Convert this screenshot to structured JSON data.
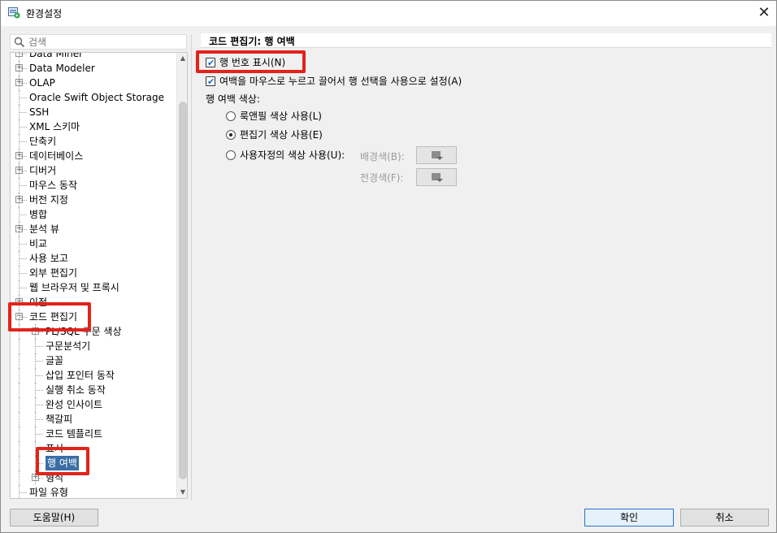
{
  "window": {
    "title": "환경설정"
  },
  "search": {
    "placeholder": "검색"
  },
  "tree": {
    "items": [
      {
        "label": "Data Miner",
        "expandable": true
      },
      {
        "label": "Data Modeler",
        "expandable": true
      },
      {
        "label": "OLAP",
        "expandable": true
      },
      {
        "label": "Oracle Swift Object Storage",
        "expandable": false
      },
      {
        "label": "SSH",
        "expandable": false
      },
      {
        "label": "XML 스키마",
        "expandable": false
      },
      {
        "label": "단축키",
        "expandable": false
      },
      {
        "label": "데이터베이스",
        "expandable": true
      },
      {
        "label": "디버거",
        "expandable": true
      },
      {
        "label": "마우스 동작",
        "expandable": false
      },
      {
        "label": "버전 지정",
        "expandable": true
      },
      {
        "label": "병합",
        "expandable": false
      },
      {
        "label": "분석 뷰",
        "expandable": true
      },
      {
        "label": "비교",
        "expandable": false
      },
      {
        "label": "사용 보고",
        "expandable": false
      },
      {
        "label": "외부 편집기",
        "expandable": false
      },
      {
        "label": "웹 브라우저 및 프록시",
        "expandable": false
      },
      {
        "label": "이전",
        "expandable": true
      },
      {
        "label": "코드 편집기",
        "expandable": true,
        "expanded": true
      },
      {
        "label": "PL/SQL 구문 색상",
        "expandable": true,
        "child": true
      },
      {
        "label": "구문분석기",
        "child": true
      },
      {
        "label": "글꼴",
        "child": true
      },
      {
        "label": "삽입 포인터 동작",
        "child": true
      },
      {
        "label": "실행 취소 동작",
        "child": true
      },
      {
        "label": "완성 인사이트",
        "child": true
      },
      {
        "label": "책갈피",
        "child": true
      },
      {
        "label": "코드 템플리트",
        "child": true
      },
      {
        "label": "표시",
        "child": true
      },
      {
        "label": "행 여백",
        "child": true,
        "selected": true
      },
      {
        "label": "형식",
        "expandable": true,
        "child": true
      },
      {
        "label": "파일 유형",
        "expandable": false
      }
    ]
  },
  "panel": {
    "title": "코드 편집기: 행 여백",
    "show_line_numbers": {
      "label": "행 번호 표시(N)",
      "checked": true
    },
    "select_lines_drag": {
      "label": "여백을 마우스로 누르고 끌어서 행 선택을 사용으로 설정(A)",
      "checked": true
    },
    "margin_color_label": "행 여백 색상:",
    "radio_look_feel": "룩앤필 색상 사용(L)",
    "radio_editor": "편집기 색상 사용(E)",
    "radio_custom": "사용자정의 색상 사용(U):",
    "background_label": "배경색(B):",
    "foreground_label": "전경색(F):",
    "selected_radio": "editor"
  },
  "buttons": {
    "help": "도움말(H)",
    "ok": "확인",
    "cancel": "취소"
  }
}
